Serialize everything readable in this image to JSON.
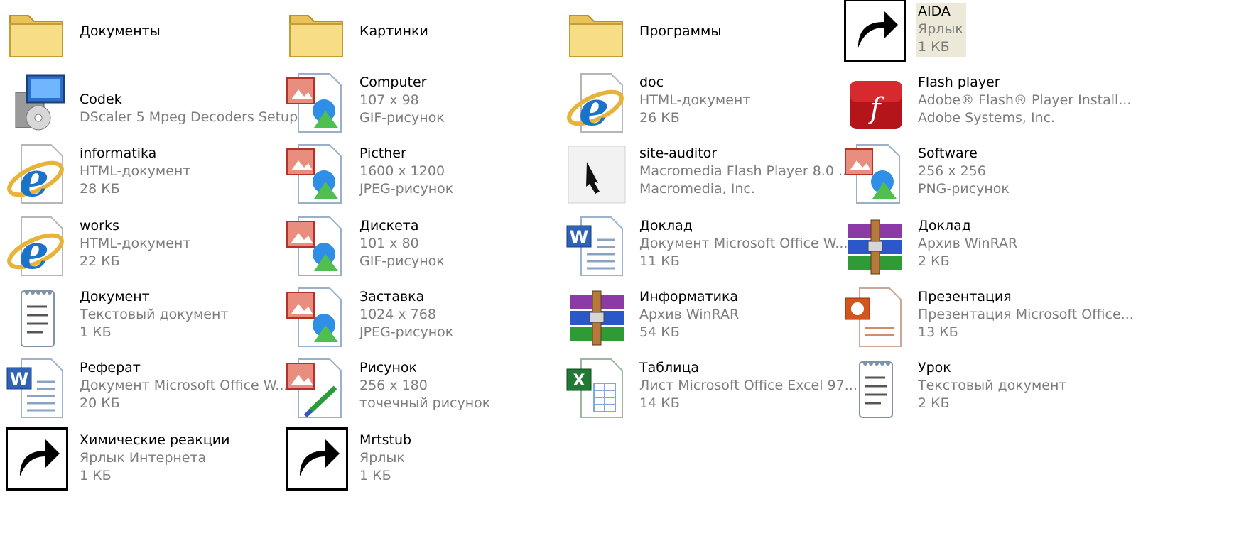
{
  "items": [
    {
      "name": "Документы",
      "line2": "",
      "line3": "",
      "icon": "folder-icon"
    },
    {
      "name": "Картинки",
      "line2": "",
      "line3": "",
      "icon": "folder-icon"
    },
    {
      "name": "Программы",
      "line2": "",
      "line3": "",
      "icon": "folder-icon"
    },
    {
      "name": "AIDA",
      "line2": "Ярлык",
      "line3": "1 КБ",
      "icon": "aida64-icon",
      "shortcut": true,
      "selected": true
    },
    {
      "name": "Codek",
      "line2": "DScaler 5 Mpeg Decoders Setup",
      "line3": "",
      "icon": "installer-icon"
    },
    {
      "name": "Computer",
      "line2": "107 x 98",
      "line3": "GIF-рисунок",
      "icon": "image-file-icon"
    },
    {
      "name": "doc",
      "line2": "HTML-документ",
      "line3": "26 КБ",
      "icon": "ie-html-icon"
    },
    {
      "name": "Flash player",
      "line2": "Adobe® Flash® Player Install...",
      "line3": "Adobe Systems, Inc.",
      "icon": "flash-player-icon"
    },
    {
      "name": "informatika",
      "line2": "HTML-документ",
      "line3": "28 КБ",
      "icon": "ie-html-icon"
    },
    {
      "name": "Picther",
      "line2": "1600 x 1200",
      "line3": "JPEG-рисунок",
      "icon": "image-file-icon"
    },
    {
      "name": "site-auditor",
      "line2": "Macromedia Flash Player 8.0 ...",
      "line3": "Macromedia, Inc.",
      "icon": "site-auditor-icon"
    },
    {
      "name": "Software",
      "line2": "256 x 256",
      "line3": "PNG-рисунок",
      "icon": "image-file-icon"
    },
    {
      "name": "works",
      "line2": "HTML-документ",
      "line3": "22 КБ",
      "icon": "ie-html-icon"
    },
    {
      "name": "Дискета",
      "line2": "101 x 80",
      "line3": "GIF-рисунок",
      "icon": "image-file-icon"
    },
    {
      "name": "Доклад",
      "line2": "Документ Microsoft Office W...",
      "line3": "11 КБ",
      "icon": "word-doc-icon"
    },
    {
      "name": "Доклад",
      "line2": "Архив WinRAR",
      "line3": "2 КБ",
      "icon": "winrar-icon"
    },
    {
      "name": "Документ",
      "line2": "Текстовый документ",
      "line3": "1 КБ",
      "icon": "text-doc-icon"
    },
    {
      "name": "Заставка",
      "line2": "1024 x 768",
      "line3": "JPEG-рисунок",
      "icon": "image-file-icon"
    },
    {
      "name": "Информатика",
      "line2": "Архив WinRAR",
      "line3": "54 КБ",
      "icon": "winrar-icon"
    },
    {
      "name": "Презентация",
      "line2": "Презентация Microsoft Office...",
      "line3": "13 КБ",
      "icon": "powerpoint-icon"
    },
    {
      "name": "Реферат",
      "line2": "Документ Microsoft Office W...",
      "line3": "20 КБ",
      "icon": "word-doc-icon"
    },
    {
      "name": "Рисунок",
      "line2": "256 x 180",
      "line3": "точечный рисунок",
      "icon": "paint-bitmap-icon"
    },
    {
      "name": "Таблица",
      "line2": "Лист Microsoft Office Excel 97...",
      "line3": "14 КБ",
      "icon": "excel-icon"
    },
    {
      "name": "Урок",
      "line2": "Текстовый документ",
      "line3": "2 КБ",
      "icon": "text-doc-icon"
    },
    {
      "name": "Химические реакции",
      "line2": "Ярлык Интернета",
      "line3": "1 КБ",
      "icon": "ie-html-icon",
      "shortcut": true
    },
    {
      "name": "Mrtstub",
      "line2": "Ярлык",
      "line3": "1 КБ",
      "icon": "monitor-shortcut-icon",
      "shortcut": true
    }
  ]
}
